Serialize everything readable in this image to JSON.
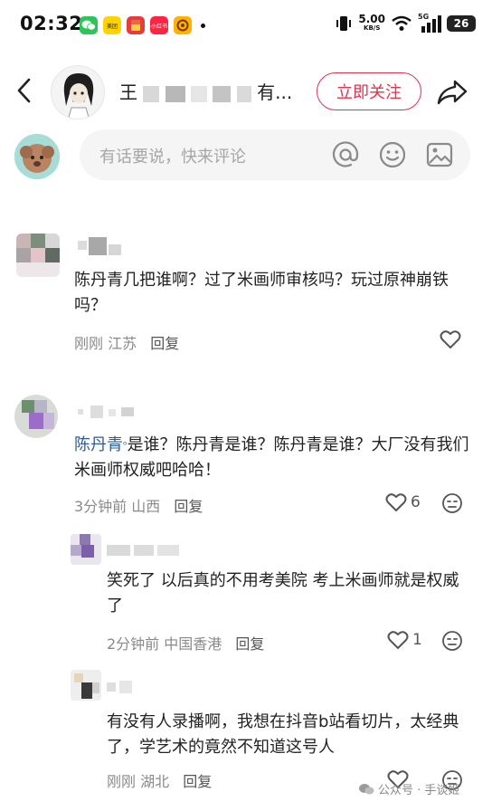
{
  "status_bar": {
    "time": "02:32",
    "apps": [
      {
        "name": "wechat-icon",
        "label": "",
        "color": "#2ec45a"
      },
      {
        "name": "meituan-icon",
        "label": "美团",
        "color": "#ffd200"
      },
      {
        "name": "redpacket-icon",
        "label": "",
        "color": "#e63c3c"
      },
      {
        "name": "xiaohongshu-icon",
        "label": "小红书",
        "color": "#ff2442"
      },
      {
        "name": "taobao-icon",
        "label": "",
        "color": "#ff8a00"
      }
    ],
    "net_speed": "5.00",
    "net_unit": "KB/S",
    "network": "5G",
    "battery": "26"
  },
  "header": {
    "author_name_visible_start": "王",
    "author_name_visible_end": "有...",
    "follow_label": "立即关注"
  },
  "compose": {
    "placeholder": "有话要说，快来评论"
  },
  "comments": [
    {
      "text": "陈丹青几把谁啊？过了米画师审核吗？玩过原神崩铁吗？",
      "time": "刚刚",
      "location": "江苏",
      "reply_label": "回复",
      "likes": ""
    },
    {
      "mention": "陈丹青",
      "text": "是谁？陈丹青是谁？陈丹青是谁？大厂没有我们米画师权威吧哈哈！",
      "time": "3分钟前",
      "location": "山西",
      "reply_label": "回复",
      "likes": "6"
    },
    {
      "text": "笑死了 以后真的不用考美院 考上米画师就是权威了",
      "time": "2分钟前",
      "location": "中国香港",
      "reply_label": "回复",
      "likes": "1"
    },
    {
      "text": "有没有人录播啊，我想在抖音b站看切片，太经典了，学艺术的竟然不知道这号人",
      "time": "刚刚",
      "location": "湖北",
      "reply_label": "回复",
      "likes": ""
    }
  ],
  "watermark": "公众号 · 手谈姬"
}
